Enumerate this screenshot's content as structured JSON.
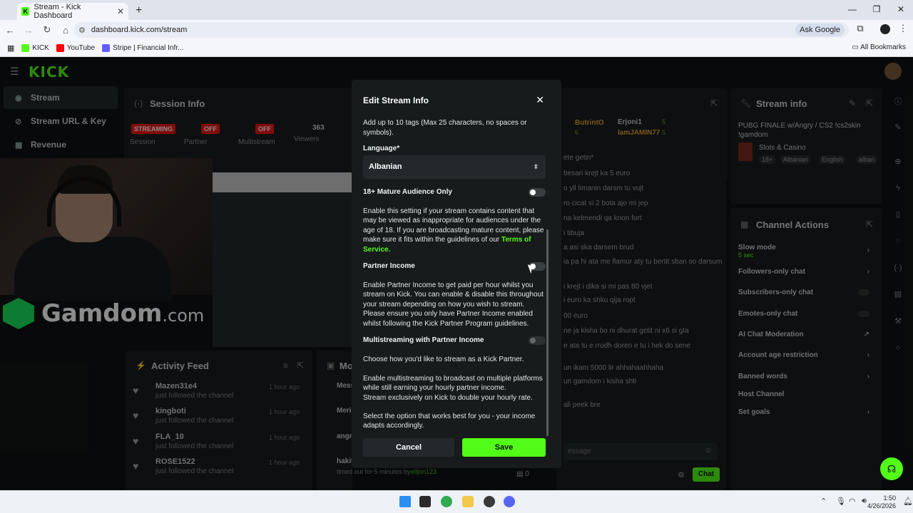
{
  "browser": {
    "tab_title": "Stream - Kick Dashboard",
    "tab_favicon": "K",
    "url": "dashboard.kick.com/stream",
    "ask_google": "Ask Google",
    "bookmarks": [
      {
        "label": "KICK",
        "color": "#53fc18"
      },
      {
        "label": "YouTube",
        "color": "#ff0000"
      },
      {
        "label": "Stripe | Financial Infr...",
        "color": "#635bff"
      }
    ],
    "all_bookmarks": "All Bookmarks"
  },
  "app": {
    "logo": "KICK",
    "sidebar": [
      {
        "label": "Stream",
        "icon": "broadcast-icon"
      },
      {
        "label": "Stream URL & Key",
        "icon": "link-icon"
      },
      {
        "label": "Revenue",
        "icon": "revenue-icon"
      }
    ],
    "session": {
      "title": "Session Info",
      "badges": [
        "STREAMING",
        "OFF",
        "OFF"
      ],
      "labels": [
        "Session",
        "Partner",
        "Multistream"
      ],
      "viewers_value": "363",
      "viewers_label": "Viewers"
    },
    "overlay_brand": {
      "name": "Gamdom",
      "suffix": ".com"
    },
    "activity": {
      "title": "Activity Feed",
      "items": [
        {
          "name": "Mazen31e4",
          "sub": "just followed the channel",
          "time": "1 hour ago"
        },
        {
          "name": "kingboti",
          "sub": "just followed the channel",
          "time": "1 hour ago"
        },
        {
          "name": "FLA_10",
          "sub": "just followed the channel",
          "time": "1 hour ago"
        },
        {
          "name": "ROSE1522",
          "sub": "just followed the channel",
          "time": "1 hour ago"
        }
      ]
    },
    "mod_panel": {
      "title": "Mo",
      "items": [
        "Mess",
        "Meri",
        "angr",
        "hakit"
      ],
      "timeout_text": "timed out for 5 minutes by",
      "timeout_by": "elljon123"
    },
    "chat": {
      "top_users": [
        {
          "name": "ButrintO",
          "count": "6"
        },
        {
          "name": "Erjoni1",
          "count": "5"
        },
        {
          "name": "IamJAMIN77",
          "count": "5"
        }
      ],
      "lines": [
        "ete getin*",
        "besari krejt ka 5 euro",
        "o yll limanin darsm tu vujt",
        "ro cicat si 2 bota ajo mi jep",
        "na kelmendi qa knon fort",
        "i tibuja",
        "a asi ska darsem brud",
        "ia pa hi ata me flamur aty tu bertit sban so darsum",
        "",
        "i krejt i dika si mi pas 80 vjet",
        "i euro ka shku qija ropt",
        "00 euro",
        "ne ja kisha bo ni dhurat getit ni x6 si gta",
        "e ata tu e rrudh doren e tu i hek do sene",
        "un ikam 5000 lir ahhahaahhaha",
        "un gamdom i kisha shti",
        "ali peek bre"
      ],
      "placeholder": "essage",
      "count": "0",
      "button": "Chat"
    },
    "stream_info": {
      "title": "Stream info",
      "stream_title": "PUBG FINALE w/Angry / CS2 !cs2skin !gamdom",
      "category": "Slots & Casino",
      "tags": [
        "18+",
        "Albanian",
        "English",
        "alban"
      ]
    },
    "channel_actions": {
      "title": "Channel Actions",
      "items": [
        {
          "label": "Slow mode",
          "sub": "5 sec",
          "control": "chevron"
        },
        {
          "label": "Followers-only chat",
          "sub": "",
          "control": "chevron"
        },
        {
          "label": "Subscribers-only chat",
          "sub": "",
          "control": "toggle"
        },
        {
          "label": "Emotes-only chat",
          "sub": "",
          "control": "toggle"
        },
        {
          "label": "AI Chat Moderation",
          "sub": "",
          "control": "external"
        },
        {
          "label": "Account age restriction",
          "sub": "",
          "control": "chevron"
        },
        {
          "label": "Banned words",
          "sub": "",
          "control": "chevron"
        },
        {
          "label": "Host Channel",
          "sub": "",
          "control": "none"
        },
        {
          "label": "Set goals",
          "sub": "",
          "control": "chevron"
        }
      ]
    }
  },
  "modal": {
    "title": "Edit Stream Info",
    "tags_hint": "Add up to 10 tags (Max 25 characters, no spaces or symbols).",
    "language_label": "Language*",
    "language_value": "Albanian",
    "mature_label": "18+ Mature Audience Only",
    "mature_text": "Enable this setting if your stream contains content that may be viewed as inappropriate for audiences under the age of 18. If you are broadcasting mature content, please make sure it fits within the guidelines of our",
    "tos": "Terms of Service.",
    "partner_label": "Partner Income",
    "partner_text": "Enable Partner Income to get paid per hour whilst you stream on Kick. You can enable & disable this throughout your stream depending on how you wish to stream. Please ensure you only have Partner Income enabled whilst following the Kick Partner Program guidelines.",
    "multi_label": "Multistreaming with Partner Income",
    "multi_text1": "Choose how you'd like to stream as a Kick Partner.",
    "multi_text2": "Enable multistreaming to broadcast on multiple platforms while still earning your hourly partner income.",
    "multi_text3": "Stream exclusively on Kick to double your hourly rate.",
    "multi_text4": "Select the option that works best for you - your income adapts accordingly.",
    "cancel": "Cancel",
    "save": "Save"
  },
  "taskbar": {
    "time": "1:50",
    "date": "4/26/2026"
  },
  "colors": {
    "accent": "#53fc18",
    "live": "#e91916",
    "panel": "#1a1d1e"
  }
}
